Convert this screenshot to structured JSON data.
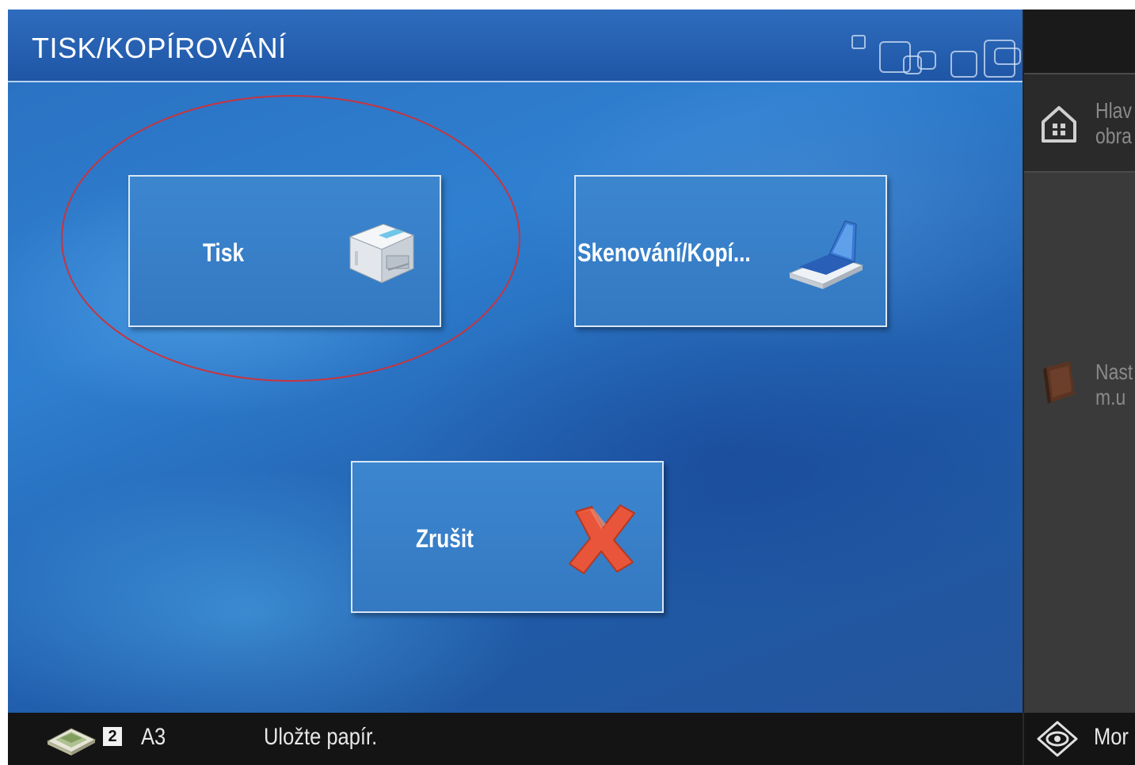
{
  "header": {
    "title": "TISK/KOPÍROVÁNÍ"
  },
  "tiles": {
    "print": {
      "label": "Tisk",
      "icon": "printer-icon"
    },
    "scan_copy": {
      "label": "Skenování/Kopí...",
      "icon": "scanner-icon"
    },
    "cancel": {
      "label": "Zrušit",
      "icon": "close-icon"
    }
  },
  "side_panel": {
    "home_line1": "Hlav",
    "home_line2": "obra",
    "settings_line1": "Nast",
    "settings_line2": "m.u"
  },
  "status_bar": {
    "tray_number": "2",
    "paper_size": "A3",
    "message": "Uložte papír.",
    "monitor_label": "Mor"
  },
  "colors": {
    "highlight": "#c8343d",
    "tile": "#3479c2",
    "cancel_x": "#e8553a"
  }
}
